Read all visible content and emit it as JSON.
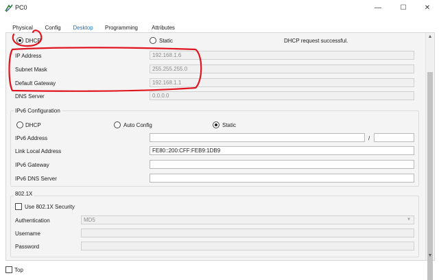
{
  "window": {
    "title": "PC0",
    "minimize": "—",
    "maximize": "☐",
    "close": "✕"
  },
  "tabs": [
    {
      "label": "Physical"
    },
    {
      "label": "Config"
    },
    {
      "label": "Desktop"
    },
    {
      "label": "Programming"
    },
    {
      "label": "Attributes"
    }
  ],
  "ipv4": {
    "dhcp_label": "DHCP",
    "static_label": "Static",
    "status": "DHCP request successful.",
    "ip_address_label": "IP Address",
    "ip_address_value": "192.168.1.6",
    "subnet_mask_label": "Subnet Mask",
    "subnet_mask_value": "255.255.255.0",
    "default_gateway_label": "Default Gateway",
    "default_gateway_value": "192.168.1.1",
    "dns_server_label": "DNS Server",
    "dns_server_value": "0.0.0.0"
  },
  "ipv6": {
    "title": "IPv6 Configuration",
    "dhcp_label": "DHCP",
    "auto_label": "Auto Config",
    "static_label": "Static",
    "address_label": "IPv6 Address",
    "address_value": "",
    "prefix_separator": "/",
    "prefix_value": "",
    "link_local_label": "Link Local Address",
    "link_local_value": "FE80::200:CFF:FEB9:1DB9",
    "gateway_label": "IPv6 Gateway",
    "gateway_value": "",
    "dns_label": "IPv6 DNS Server",
    "dns_value": ""
  },
  "dot1x": {
    "title": "802.1X",
    "use_security_label": "Use 802.1X Security",
    "authentication_label": "Authentication",
    "authentication_value": "MD5",
    "username_label": "Username",
    "username_value": "",
    "password_label": "Password",
    "password_value": ""
  },
  "footer": {
    "top_label": "Top"
  },
  "colors": {
    "accent": "#1a73c8",
    "annotation": "#e0141e"
  }
}
